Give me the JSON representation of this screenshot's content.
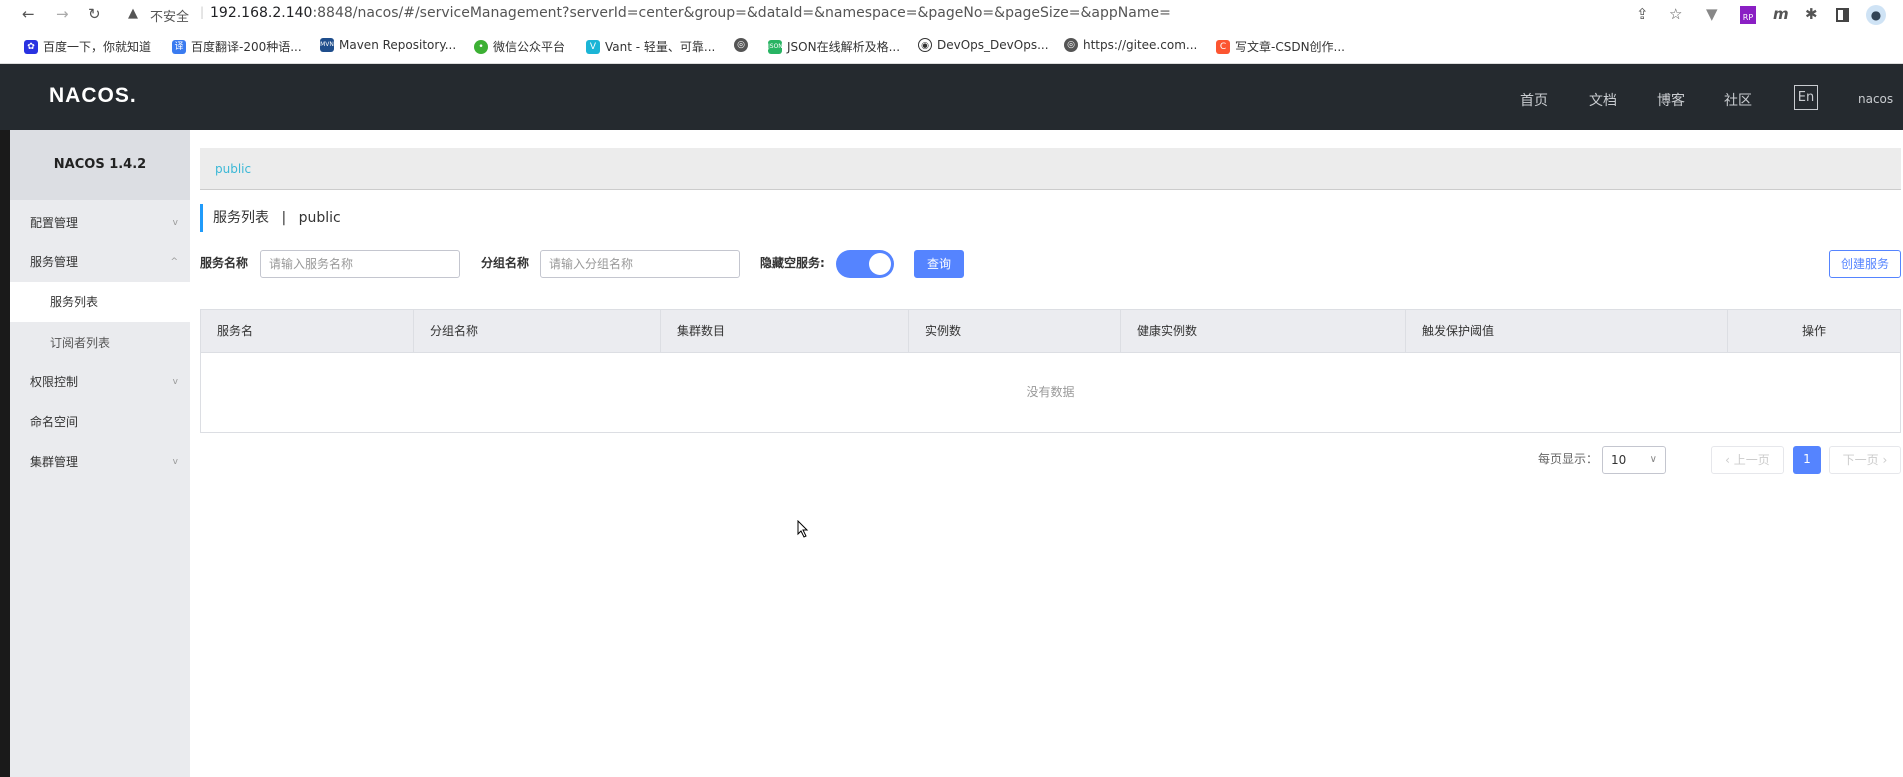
{
  "browser": {
    "insecure_label": "不安全",
    "url_host": "192.168.2.140",
    "url_rest": ":8848/nacos/#/serviceManagement?serverId=center&group=&dataId=&namespace=&pageNo=&pageSize=&appName=",
    "bookmarks": [
      {
        "label": "百度一下，你就知道",
        "icon": "baidu-icon",
        "color": "#2932e1"
      },
      {
        "label": "百度翻译-200种语...",
        "icon": "translate-icon",
        "color": "#3a7bf0"
      },
      {
        "label": "Maven Repository...",
        "icon": "maven-icon",
        "color": "#1f4e8c"
      },
      {
        "label": "微信公众平台",
        "icon": "wechat-icon",
        "color": "#3cb034"
      },
      {
        "label": "Vant - 轻量、可靠...",
        "icon": "vant-icon",
        "color": "#1bb5d6"
      },
      {
        "label": "",
        "icon": "globe-icon",
        "color": "#555555"
      },
      {
        "label": "JSON在线解析及格...",
        "icon": "json-icon",
        "color": "#28b463"
      },
      {
        "label": "DevOps_DevOps...",
        "icon": "devops-icon",
        "color": "#333333"
      },
      {
        "label": "https://gitee.com...",
        "icon": "globe-icon",
        "color": "#555555"
      },
      {
        "label": "写文章-CSDN创作...",
        "icon": "csdn-icon",
        "color": "#fc5531"
      }
    ]
  },
  "header": {
    "logo": "NACOS.",
    "nav": [
      "首页",
      "文档",
      "博客",
      "社区"
    ],
    "lang": "En",
    "user": "nacos"
  },
  "sidebar": {
    "title": "NACOS 1.4.2",
    "items": [
      {
        "label": "配置管理",
        "chevron": "v"
      },
      {
        "label": "服务管理",
        "chevron": "^"
      },
      {
        "label": "服务列表"
      },
      {
        "label": "订阅者列表"
      },
      {
        "label": "权限控制",
        "chevron": "v"
      },
      {
        "label": "命名空间"
      },
      {
        "label": "集群管理",
        "chevron": "v"
      }
    ]
  },
  "main": {
    "namespace_tab": "public",
    "title": "服务列表",
    "title_sep": "|",
    "title_ns": "public",
    "form": {
      "service_name_label": "服务名称",
      "service_name_placeholder": "请输入服务名称",
      "service_name_value": "",
      "group_name_label": "分组名称",
      "group_name_placeholder": "请输入分组名称",
      "group_name_value": "",
      "hide_empty_label": "隐藏空服务:",
      "hide_empty_on": true,
      "query_button": "查询",
      "create_button": "创建服务"
    },
    "table": {
      "columns": [
        "服务名",
        "分组名称",
        "集群数目",
        "实例数",
        "健康实例数",
        "触发保护阈值",
        "操作"
      ],
      "rows": [],
      "empty_text": "没有数据"
    },
    "pagination": {
      "page_size_label": "每页显示：",
      "page_size": "10",
      "prev": "上一页",
      "current_page": "1",
      "next": "下一页"
    }
  },
  "colors": {
    "primary": "#5584ff",
    "nav_bg": "#252a2f",
    "accent": "#3bb8d6"
  }
}
